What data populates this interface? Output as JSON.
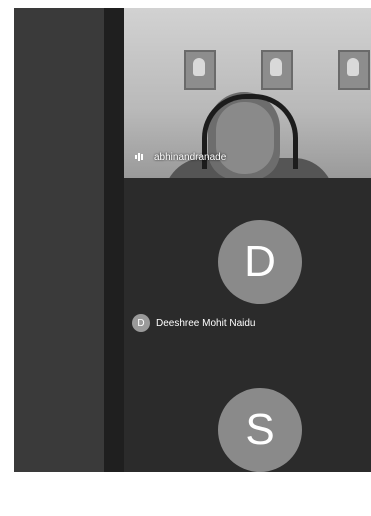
{
  "video_tile": {
    "participant_name": "abhinandranade"
  },
  "participants": [
    {
      "initial": "D",
      "badge_initial": "D",
      "name": "Deeshree Mohit Naidu"
    },
    {
      "initial": "S"
    }
  ],
  "colors": {
    "panel": "#2b2b2b",
    "avatar": "#8a8a8a",
    "text": "#ffffff"
  }
}
